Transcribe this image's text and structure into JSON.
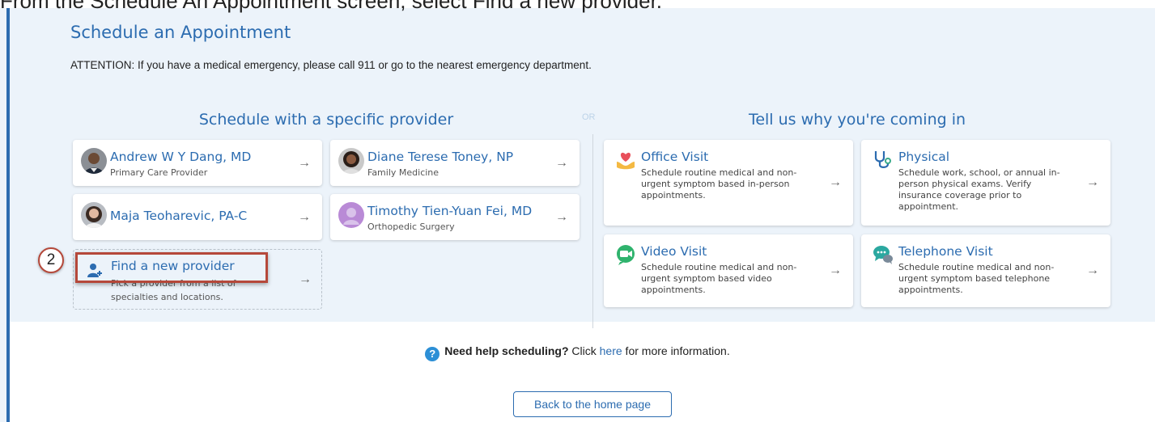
{
  "caption": "From the Schedule An Appointment screen, select Find a new provider.",
  "page": {
    "title": "Schedule an Appointment",
    "attention": "ATTENTION: If you have a medical emergency, please call 911 or go to the nearest emergency department."
  },
  "specific": {
    "heading": "Schedule with a specific provider",
    "providers": [
      {
        "name": "Andrew W Y Dang, MD",
        "role": "Primary Care Provider",
        "arrow": "→"
      },
      {
        "name": "Diane Terese Toney, NP",
        "role": "Family Medicine",
        "arrow": "→"
      },
      {
        "name": "Maja Teoharevic, PA-C",
        "role": "",
        "arrow": "→"
      },
      {
        "name": "Timothy Tien-Yuan Fei, MD",
        "role": "Orthopedic Surgery",
        "arrow": "→"
      }
    ],
    "find_new": {
      "label": "Find a new provider",
      "sub": "Pick a provider from a list of specialties and locations.",
      "arrow": "→"
    }
  },
  "or_label": "OR",
  "reason": {
    "heading": "Tell us why you're coming in",
    "visits": [
      {
        "name": "Office Visit",
        "desc": "Schedule routine medical and non-urgent symptom based in-person appointments.",
        "icon": "heart-hand-icon",
        "arrow": "→"
      },
      {
        "name": "Physical",
        "desc": "Schedule work, school, or annual in-person physical exams. Verify insurance coverage prior to appointment.",
        "icon": "stethoscope-icon",
        "arrow": "→"
      },
      {
        "name": "Video Visit",
        "desc": "Schedule routine medical and non-urgent symptom based video appointments.",
        "icon": "video-camera-icon",
        "arrow": "→"
      },
      {
        "name": "Telephone Visit",
        "desc": "Schedule routine medical and non-urgent symptom based telephone appointments.",
        "icon": "chat-bubbles-icon",
        "arrow": "→"
      }
    ]
  },
  "annotation": {
    "step": "2"
  },
  "help": {
    "icon": "?",
    "bold": "Need help scheduling?",
    "pre_link": " Click ",
    "link": "here",
    "post_link": " for more information."
  },
  "home_button": "Back to the home page",
  "colors": {
    "accent": "#2c6cb0",
    "background": "#ecf3fa",
    "annotation": "#b5483a"
  }
}
